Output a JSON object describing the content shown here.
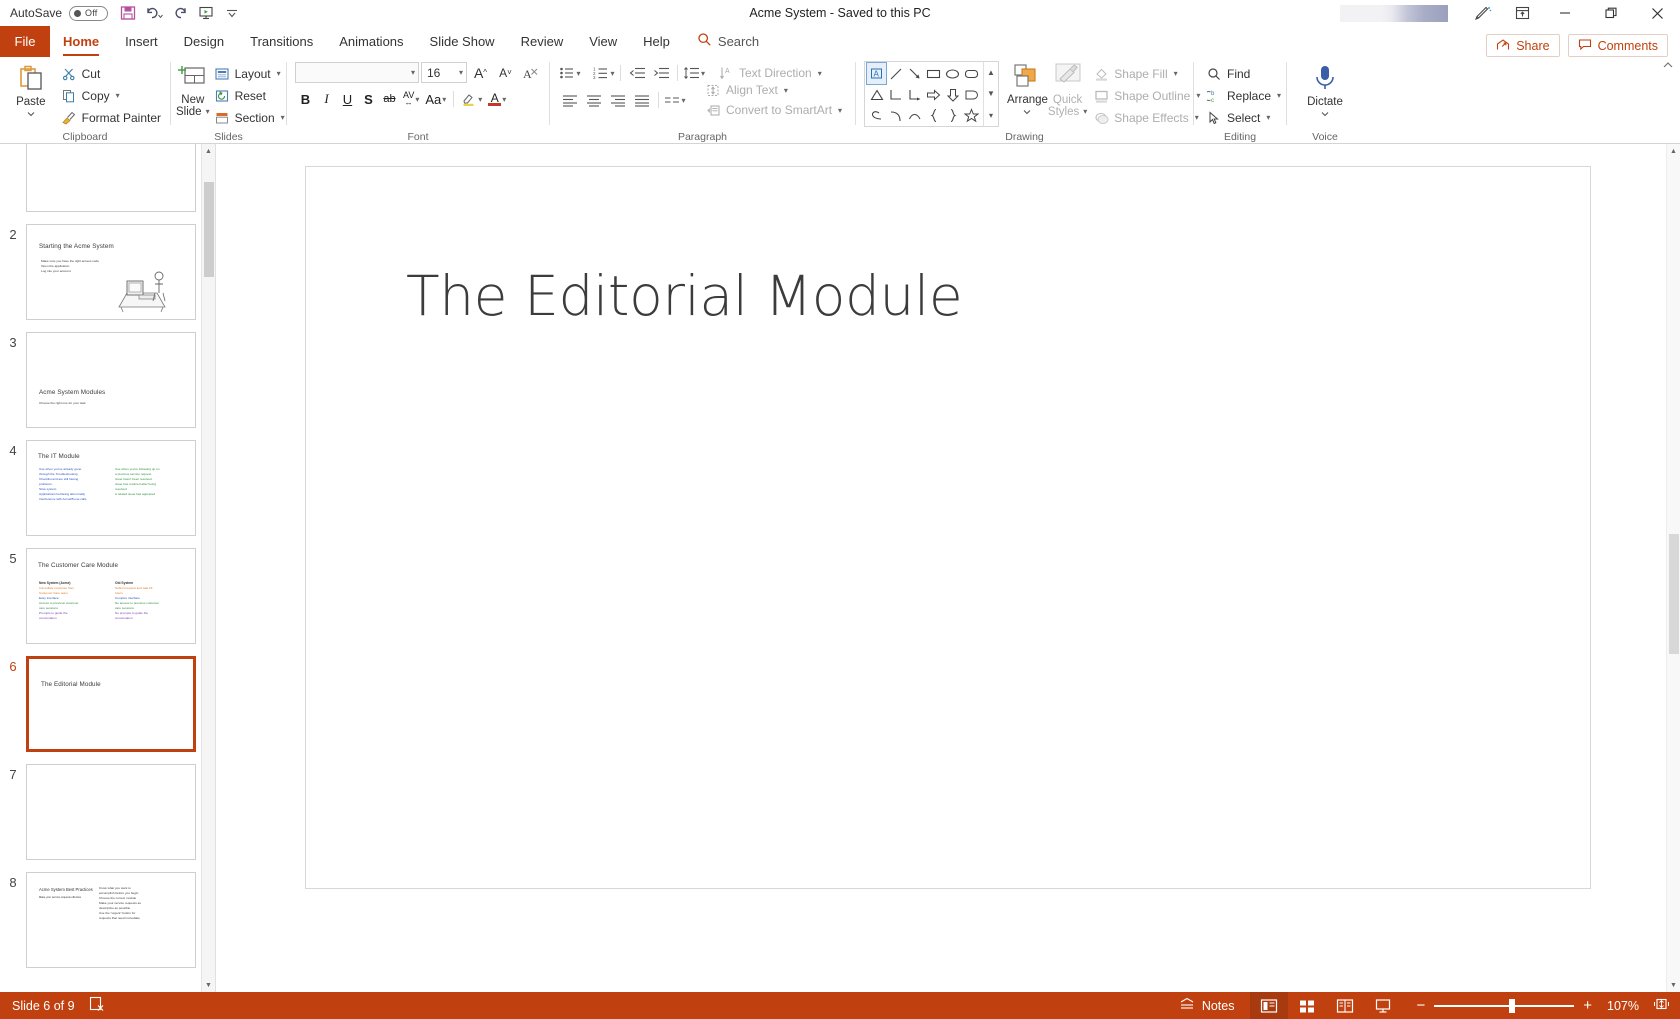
{
  "titlebar": {
    "autosave_label": "AutoSave",
    "autosave_state": "Off",
    "document_title": "Acme System  -  Saved to this PC",
    "quick_access": [
      {
        "name": "save-icon",
        "tooltip": "Save"
      },
      {
        "name": "undo-icon",
        "tooltip": "Undo"
      },
      {
        "name": "redo-icon",
        "tooltip": "Redo"
      },
      {
        "name": "start-presentation-icon",
        "tooltip": "Start From Beginning"
      },
      {
        "name": "customize-qat-icon",
        "tooltip": "Customize Quick Access Toolbar"
      }
    ],
    "window_controls": [
      {
        "name": "ink-pen-icon"
      },
      {
        "name": "ribbon-display-options-icon"
      },
      {
        "name": "minimize-button",
        "glyph": "—"
      },
      {
        "name": "restore-button",
        "glyph": "❐"
      },
      {
        "name": "close-button",
        "glyph": "✕"
      }
    ]
  },
  "tabs": {
    "file_label": "File",
    "items": [
      {
        "label": "Home",
        "active": true
      },
      {
        "label": "Insert",
        "active": false
      },
      {
        "label": "Design",
        "active": false
      },
      {
        "label": "Transitions",
        "active": false
      },
      {
        "label": "Animations",
        "active": false
      },
      {
        "label": "Slide Show",
        "active": false
      },
      {
        "label": "Review",
        "active": false
      },
      {
        "label": "View",
        "active": false
      },
      {
        "label": "Help",
        "active": false
      }
    ],
    "search_placeholder": "Search",
    "share_label": "Share",
    "comments_label": "Comments"
  },
  "ribbon": {
    "groups": [
      {
        "name": "Clipboard"
      },
      {
        "name": "Slides"
      },
      {
        "name": "Font"
      },
      {
        "name": "Paragraph"
      },
      {
        "name": "Drawing"
      },
      {
        "name": "Editing"
      },
      {
        "name": "Voice"
      }
    ],
    "clipboard": {
      "paste_label": "Paste",
      "cut_label": "Cut",
      "copy_label": "Copy",
      "format_painter_label": "Format Painter"
    },
    "slides": {
      "new_slide_label_1": "New",
      "new_slide_label_2": "Slide",
      "layout_label": "Layout",
      "reset_label": "Reset",
      "section_label": "Section"
    },
    "font": {
      "font_name_value": "",
      "font_size_value": "16",
      "grow_font": "A",
      "shrink_font": "A",
      "clear_formatting": "A",
      "bold": "B",
      "italic": "I",
      "underline": "U",
      "shadow": "S",
      "strikethrough": "ab",
      "char_spacing": "AV",
      "change_case": "Aa",
      "highlight": "highlight-icon",
      "font_color": "A"
    },
    "paragraph": {
      "text_direction_label": "Text Direction",
      "align_text_label": "Align Text",
      "convert_smartart_label": "Convert to SmartArt"
    },
    "drawing": {
      "arrange_label": "Arrange",
      "quick_styles_label_1": "Quick",
      "quick_styles_label_2": "Styles",
      "shape_fill_label": "Shape Fill",
      "shape_outline_label": "Shape Outline",
      "shape_effects_label": "Shape Effects"
    },
    "editing": {
      "find_label": "Find",
      "replace_label": "Replace",
      "select_label": "Select"
    },
    "voice": {
      "dictate_label": "Dictate"
    }
  },
  "thumbnails": [
    {
      "number": "",
      "selected": false,
      "partial_top": true,
      "title": "",
      "bullets": []
    },
    {
      "number": "2",
      "selected": false,
      "title": "Starting the Acme System",
      "bullets": [
        "Make sure you have the right access code",
        "Open the application",
        "Log into your account"
      ],
      "has_clipart": true
    },
    {
      "number": "3",
      "selected": false,
      "title": "Acme System Modules",
      "subtitle": "Choose the right one for your task",
      "bullets": []
    },
    {
      "number": "4",
      "selected": false,
      "title": "The IT Module",
      "columns": [
        {
          "color": "#2a4fc0",
          "lines": [
            "Use when you've already gone",
            "through the Troubleshooting",
            "Checklist and are still having",
            "problems.",
            "   Slow system",
            "   Applications behaving abnormally",
            "   Interference with AcmePhone calls"
          ]
        },
        {
          "color": "#2f8f3e",
          "lines": [
            "Use when you're following up on",
            "a previous service request.",
            "   Issue hasn't been resolved",
            "   Issue has returned after being",
            "   resolved",
            "   A related issue has appeared"
          ]
        }
      ]
    },
    {
      "number": "5",
      "selected": false,
      "title": "The Customer Care Module",
      "columns": [
        {
          "header": "New System (Acme)",
          "lines": [
            {
              "text": "Immediate response from",
              "color": "#e07a2a"
            },
            {
              "text": "Customer Care team",
              "color": "#e07a2a"
            },
            {
              "text": "Easy interface",
              "color": "#2a4fc0"
            },
            {
              "text": "Access to previous customer",
              "color": "#2f8f3e"
            },
            {
              "text": "care sessions",
              "color": "#2f8f3e"
            },
            {
              "text": "Prompts to guide the",
              "color": "#7a3fb5"
            },
            {
              "text": "conversation",
              "color": "#7a3fb5"
            }
          ]
        },
        {
          "header": "Old System",
          "lines": [
            {
              "text": "Submit request and wait 24",
              "color": "#e07a2a"
            },
            {
              "text": "hours",
              "color": "#e07a2a"
            },
            {
              "text": "Complex interface",
              "color": "#2a4fc0"
            },
            {
              "text": "No access to previous customer",
              "color": "#2f8f3e"
            },
            {
              "text": "care sessions",
              "color": "#2f8f3e"
            },
            {
              "text": "No prompts to guide the",
              "color": "#7a3fb5"
            },
            {
              "text": "conversation",
              "color": "#7a3fb5"
            }
          ]
        }
      ]
    },
    {
      "number": "6",
      "selected": true,
      "title": "The Editorial Module",
      "bullets": []
    },
    {
      "number": "7",
      "selected": false,
      "title": "",
      "bullets": []
    },
    {
      "number": "8",
      "selected": false,
      "title": "Acme System Best Practices",
      "subtitle": "Make your service requests effective",
      "bullets": [
        "Know what you want to",
        "accomplish before you begin",
        "Choose the correct module",
        "Make your service requests as",
        "descriptive as possible",
        "Use the \"urgent\" button for",
        "requests that need immediate"
      ]
    }
  ],
  "slide": {
    "title": "The Editorial Module"
  },
  "statusbar": {
    "slide_counter": "Slide 6 of 9",
    "accessibility_icon": "accessibility-checker-icon",
    "notes_label": "Notes",
    "views": [
      {
        "name": "normal-view",
        "active": true
      },
      {
        "name": "slide-sorter-view",
        "active": false
      },
      {
        "name": "reading-view",
        "active": false
      },
      {
        "name": "slide-show-view",
        "active": false
      }
    ],
    "zoom_out": "−",
    "zoom_in": "+",
    "zoom_level": "107%",
    "fit_slide_icon": "fit-to-window-icon"
  },
  "colors": {
    "accent": "#C0410F",
    "accent_dark": "#a83a10",
    "text": "#333333"
  }
}
